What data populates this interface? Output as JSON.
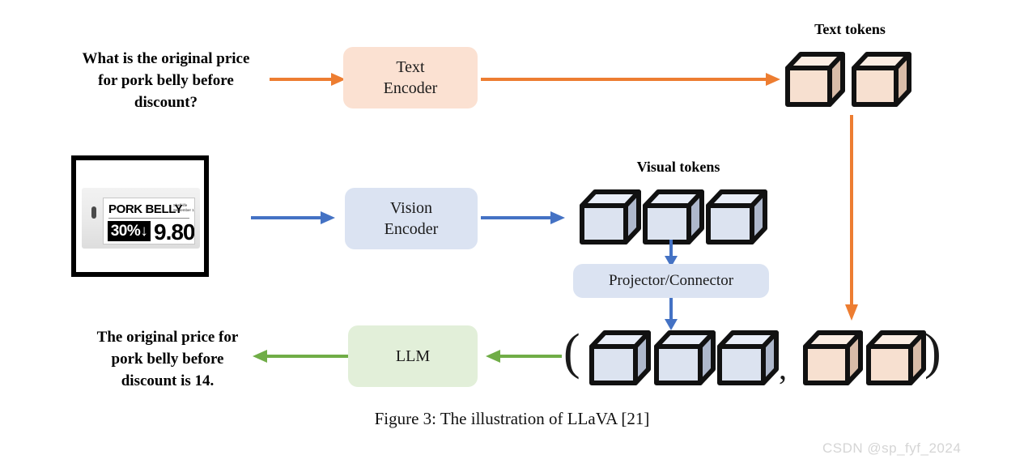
{
  "figure": {
    "caption": "Figure 3: The illustration of LLaVA [21]",
    "watermark": "CSDN @sp_fyf_2024"
  },
  "colors": {
    "orange_arrow": "#ED7D31",
    "blue_arrow": "#4472C4",
    "green_arrow": "#70AD47",
    "text_encoder_bg": "#FBE1D2",
    "vision_encoder_bg": "#DBE3F2",
    "projector_bg": "#DBE3F2",
    "llm_bg": "#E2EFD9",
    "text_token_front": "#F7E0D0",
    "text_token_top": "#FBEDE3",
    "text_token_side": "#D9BCA8",
    "visual_token_front": "#DCE3F0",
    "visual_token_top": "#E9EEF8",
    "visual_token_side": "#AEB8CC",
    "outline": "#111111"
  },
  "prompt": {
    "question": "What is the original price\nfor pork belly before\ndiscount?"
  },
  "answer": {
    "response": "The original price for\npork belly before\ndiscount is 14."
  },
  "modules": {
    "text_encoder": "Text\nEncoder",
    "vision_encoder": "Vision\nEncoder",
    "projector": "Projector/Connector",
    "llm": "LLM"
  },
  "labels": {
    "text_tokens": "Text tokens",
    "visual_tokens": "Visual tokens"
  },
  "sequence": {
    "open_paren": "(",
    "separator": ",",
    "close_paren": ")",
    "visual_token_count": 3,
    "text_token_count": 2
  },
  "shelf_label": {
    "product": "PORK BELLY",
    "meta": "Shelf life\nSeptember 1",
    "discount": "30%↓",
    "price": "9.80"
  }
}
